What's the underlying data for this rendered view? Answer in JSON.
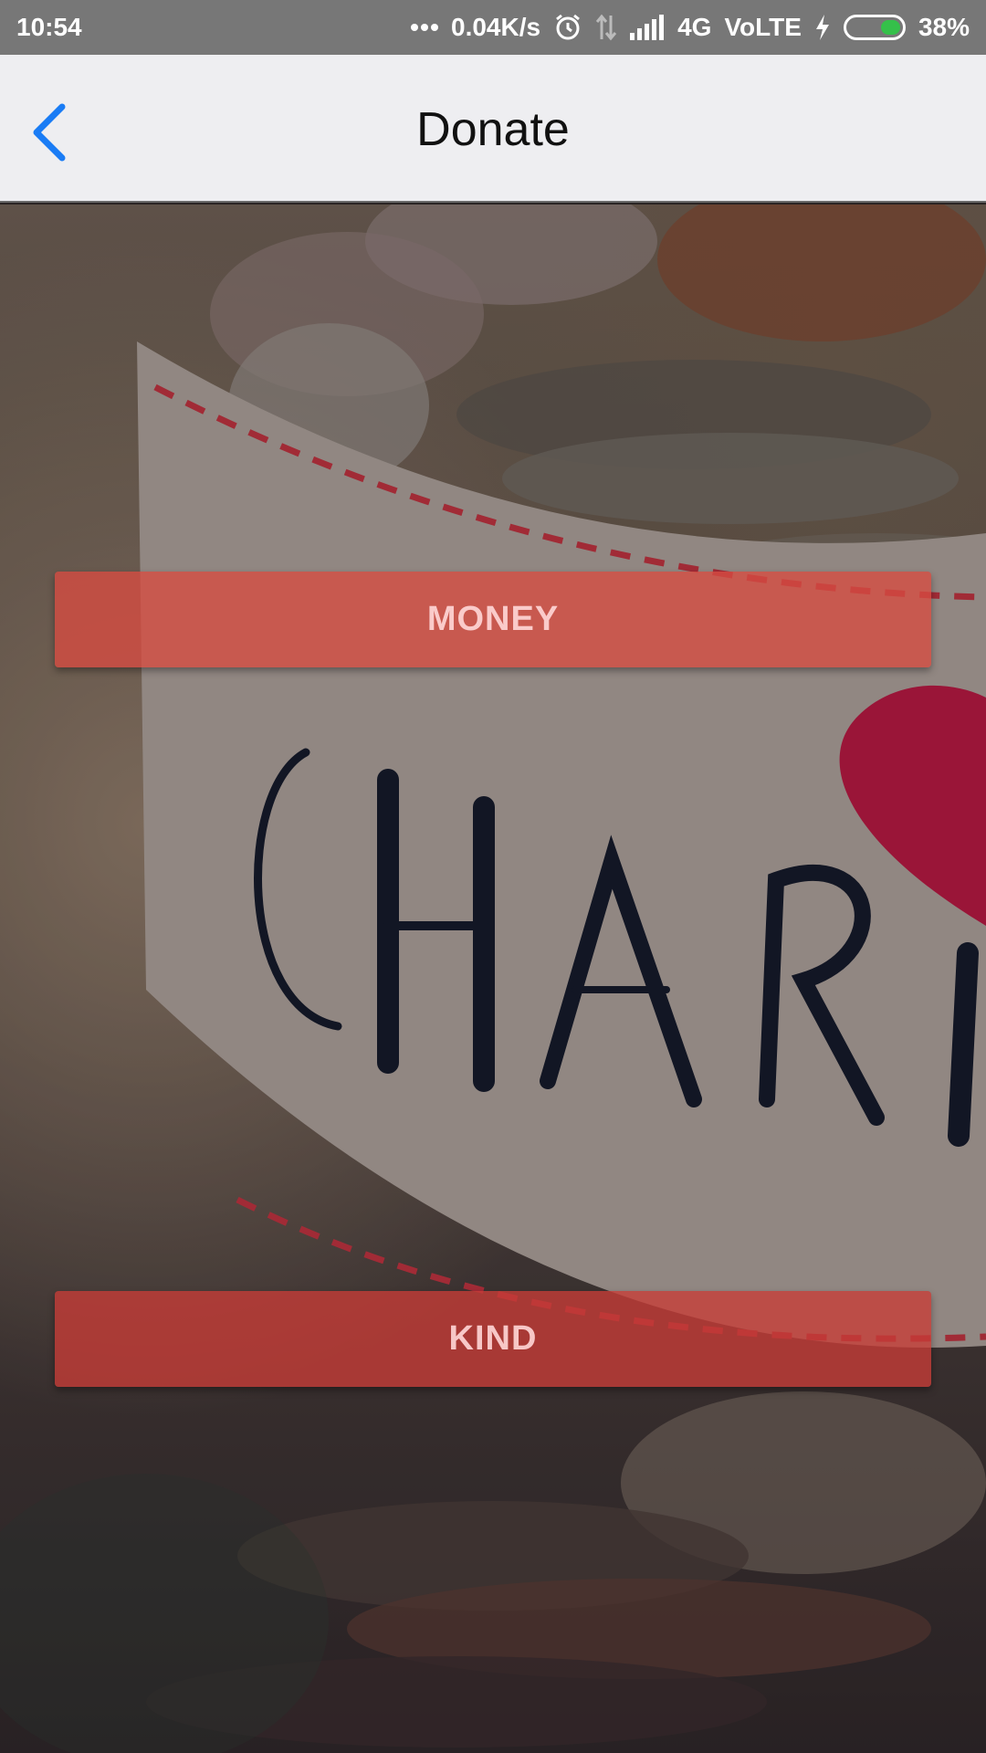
{
  "status_bar": {
    "time": "10:54",
    "network_speed": "0.04K/s",
    "network_type": "4G",
    "volte": "VoLTE",
    "battery_percent": "38%",
    "battery_level": 0.38,
    "icons": [
      "dots-icon",
      "alarm-icon",
      "data-arrows-icon",
      "signal-icon",
      "charging-icon",
      "battery-icon"
    ]
  },
  "header": {
    "title": "Donate",
    "back_icon": "chevron-left-icon"
  },
  "background": {
    "label_text": "CHARI"
  },
  "actions": {
    "money_label": "MONEY",
    "kind_label": "KIND"
  },
  "colors": {
    "accent_back": "#1a7cf5",
    "button_red": "#d74b41",
    "status_bar": "#777777",
    "nav_bar": "#eeeef1",
    "heart": "#b01840",
    "label_dash": "#b8323e"
  }
}
